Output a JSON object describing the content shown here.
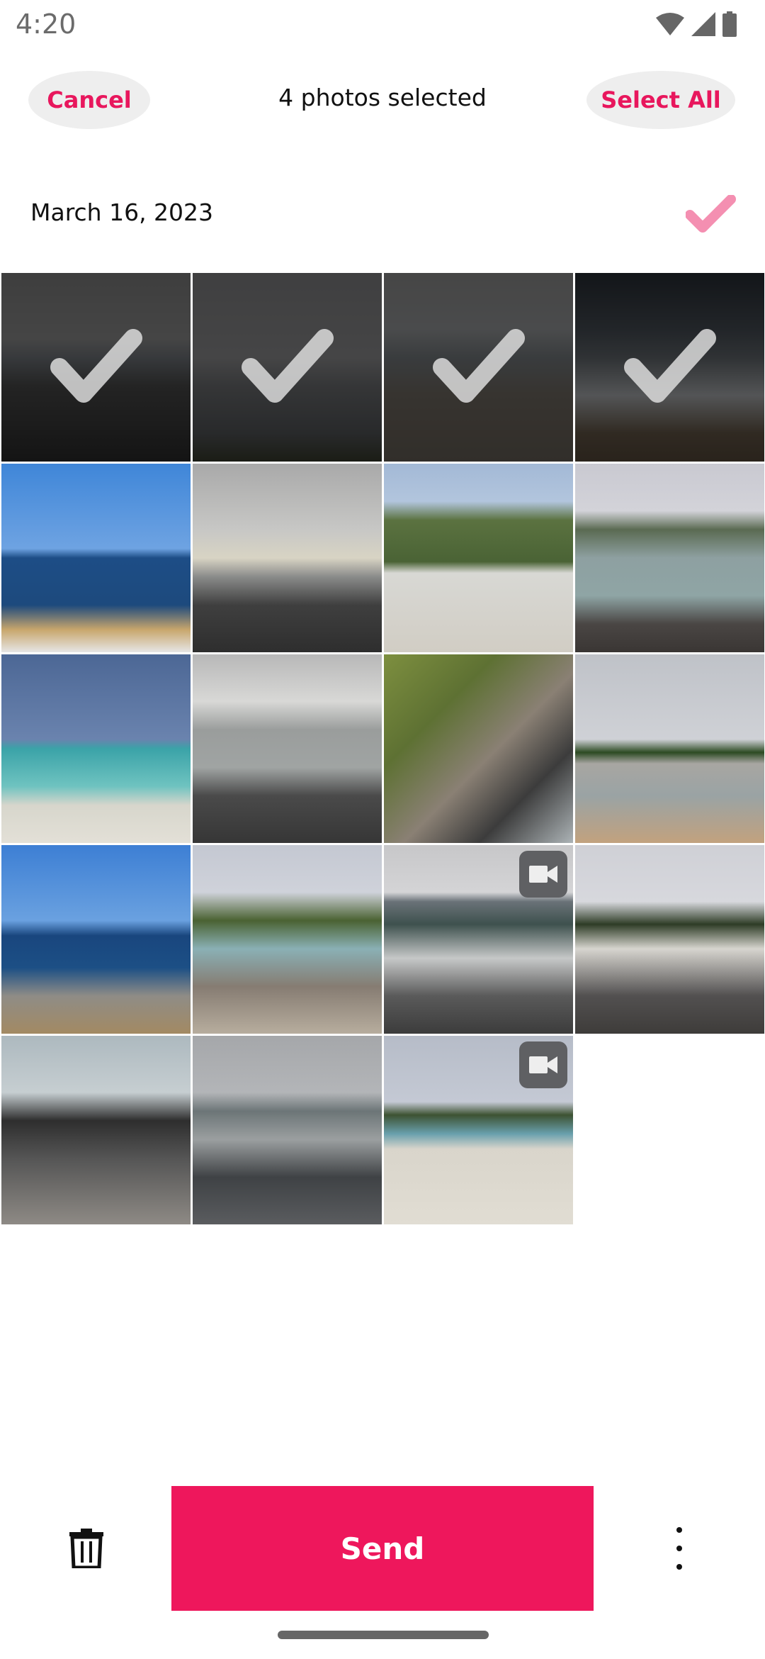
{
  "status_bar": {
    "time": "4:20",
    "icons": [
      "wifi-icon",
      "signal-icon",
      "battery-icon"
    ]
  },
  "header": {
    "cancel_label": "Cancel",
    "title": "4 photos selected",
    "select_all_label": "Select All"
  },
  "section": {
    "date": "March 16, 2023",
    "all_selected": true
  },
  "colors": {
    "accent": "#ee175c",
    "accent_light": "#f48fb1",
    "pill_bg": "#eeeeee"
  },
  "photos": [
    {
      "type": "photo",
      "selected": true,
      "scene": "rocky-shore-island"
    },
    {
      "type": "photo",
      "selected": true,
      "scene": "bay-hillside"
    },
    {
      "type": "photo",
      "selected": true,
      "scene": "beach-island"
    },
    {
      "type": "photo",
      "selected": true,
      "scene": "stormy-waves"
    },
    {
      "type": "photo",
      "selected": false,
      "scene": "blue-sea-breakwater"
    },
    {
      "type": "photo",
      "selected": false,
      "scene": "overcast-pebble-beach"
    },
    {
      "type": "photo",
      "selected": false,
      "scene": "green-hill-beach"
    },
    {
      "type": "photo",
      "selected": false,
      "scene": "mountain-bay-rocks"
    },
    {
      "type": "photo",
      "selected": false,
      "scene": "turquoise-sea-boat"
    },
    {
      "type": "photo",
      "selected": false,
      "scene": "pebble-beach-waves"
    },
    {
      "type": "photo",
      "selected": false,
      "scene": "rocky-cliff-coast"
    },
    {
      "type": "photo",
      "selected": false,
      "scene": "sandy-beach-palms"
    },
    {
      "type": "photo",
      "selected": false,
      "scene": "blue-sea-rocks"
    },
    {
      "type": "photo",
      "selected": false,
      "scene": "cove-rocks-trees"
    },
    {
      "type": "video",
      "selected": false,
      "scene": "waves-shore"
    },
    {
      "type": "photo",
      "selected": false,
      "scene": "rocky-beach-hill"
    },
    {
      "type": "photo",
      "selected": false,
      "scene": "dark-rocks-sea"
    },
    {
      "type": "photo",
      "selected": false,
      "scene": "shimmering-shore"
    },
    {
      "type": "video",
      "selected": false,
      "scene": "white-sand-beach"
    }
  ],
  "bottom_bar": {
    "send_label": "Send",
    "delete_icon": "trash-icon",
    "more_icon": "more-vert-icon"
  }
}
